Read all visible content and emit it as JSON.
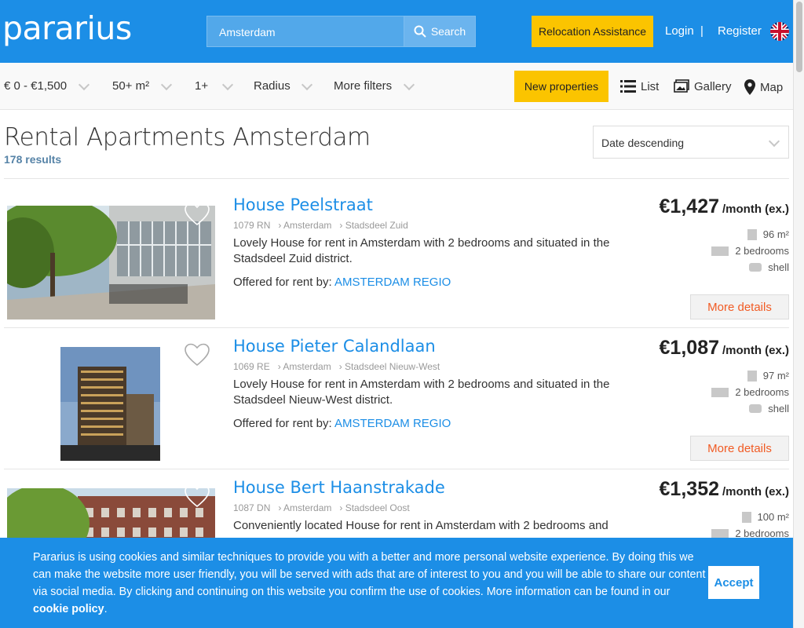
{
  "header": {
    "logo": "pararius",
    "search_value": "Amsterdam",
    "search_button": "Search",
    "relocation": "Relocation Assistance",
    "login": "Login",
    "separator": "|",
    "register": "Register"
  },
  "filters": {
    "price": "€ 0 - €1,500",
    "size": "50+ m²",
    "rooms": "1+",
    "radius": "Radius",
    "more": "More filters",
    "new_properties": "New properties",
    "view_list": "List",
    "view_gallery": "Gallery",
    "view_map": "Map"
  },
  "page": {
    "title": "Rental Apartments Amsterdam",
    "results": "178 results",
    "sort": "Date descending"
  },
  "listings": [
    {
      "title": "House Peelstraat",
      "postcode": "1079 RN",
      "city": "› Amsterdam",
      "district": "› Stadsdeel Zuid",
      "description": "Lovely House for rent in Amsterdam with 2 bedrooms and situated in the Stadsdeel Zuid district.",
      "offered_label": "Offered for rent by:",
      "agent": "AMSTERDAM REGIO",
      "price": "€1,427",
      "price_suffix": "/month (ex.)",
      "size": "96 m²",
      "bedrooms": "2 bedrooms",
      "furnishing": "shell",
      "more": "More details"
    },
    {
      "title": "House Pieter Calandlaan",
      "postcode": "1069 RE",
      "city": "› Amsterdam",
      "district": "› Stadsdeel Nieuw-West",
      "description": "Lovely House for rent in Amsterdam with 2 bedrooms and situated in the Stadsdeel Nieuw-West district.",
      "offered_label": "Offered for rent by:",
      "agent": "AMSTERDAM REGIO",
      "price": "€1,087",
      "price_suffix": "/month (ex.)",
      "size": "97 m²",
      "bedrooms": "2 bedrooms",
      "furnishing": "shell",
      "more": "More details"
    },
    {
      "title": "House Bert Haanstrakade",
      "postcode": "1087 DN",
      "city": "› Amsterdam",
      "district": "› Stadsdeel Oost",
      "description": "Conveniently located House for rent in Amsterdam with 2 bedrooms and",
      "price": "€1,352",
      "price_suffix": "/month (ex.)",
      "size": "100 m²",
      "bedrooms": "2 bedrooms"
    }
  ],
  "cookie": {
    "text": "Pararius is using cookies and similar techniques to provide you with a better and more personal website experience. By doing this we can make the website more user friendly, you will be served with ads that are of interest to you and you will be able to share our content via social media. By clicking and continuing on this website you confirm the use of cookies. More information can be found in our",
    "link": "cookie policy",
    "accept": "Accept"
  },
  "colors": {
    "brand_blue": "#1c8ee6",
    "accent_yellow": "#fbc400",
    "cta_orange": "#f15b24"
  }
}
